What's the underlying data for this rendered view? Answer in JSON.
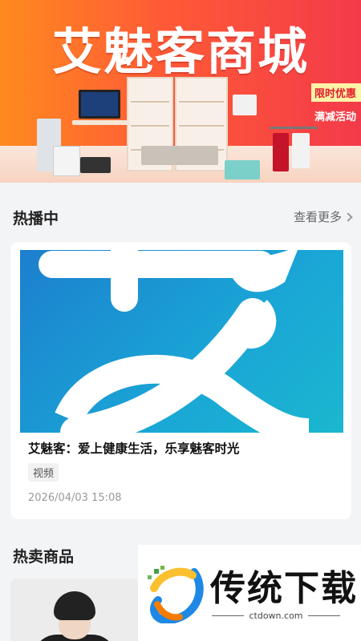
{
  "banner": {
    "title": "艾魅客商城",
    "promo_line1": "限时优惠",
    "promo_line2": "满减活动"
  },
  "hot_broadcast": {
    "title": "热播中",
    "more_label": "查看更多",
    "card": {
      "title": "艾魅客：爱上健康生活，乐享魅客时光",
      "tag": "视频",
      "date": "2026/04/03 15:08"
    }
  },
  "hot_products": {
    "title": "热卖商品"
  },
  "watermark": {
    "text": "传统下载",
    "url": "ctdown.com"
  },
  "colors": {
    "banner_start": "#ff8a1f",
    "banner_end": "#f33a4a",
    "thumb_blue": "#1c7fce",
    "page_bg": "#f3f4f6"
  }
}
